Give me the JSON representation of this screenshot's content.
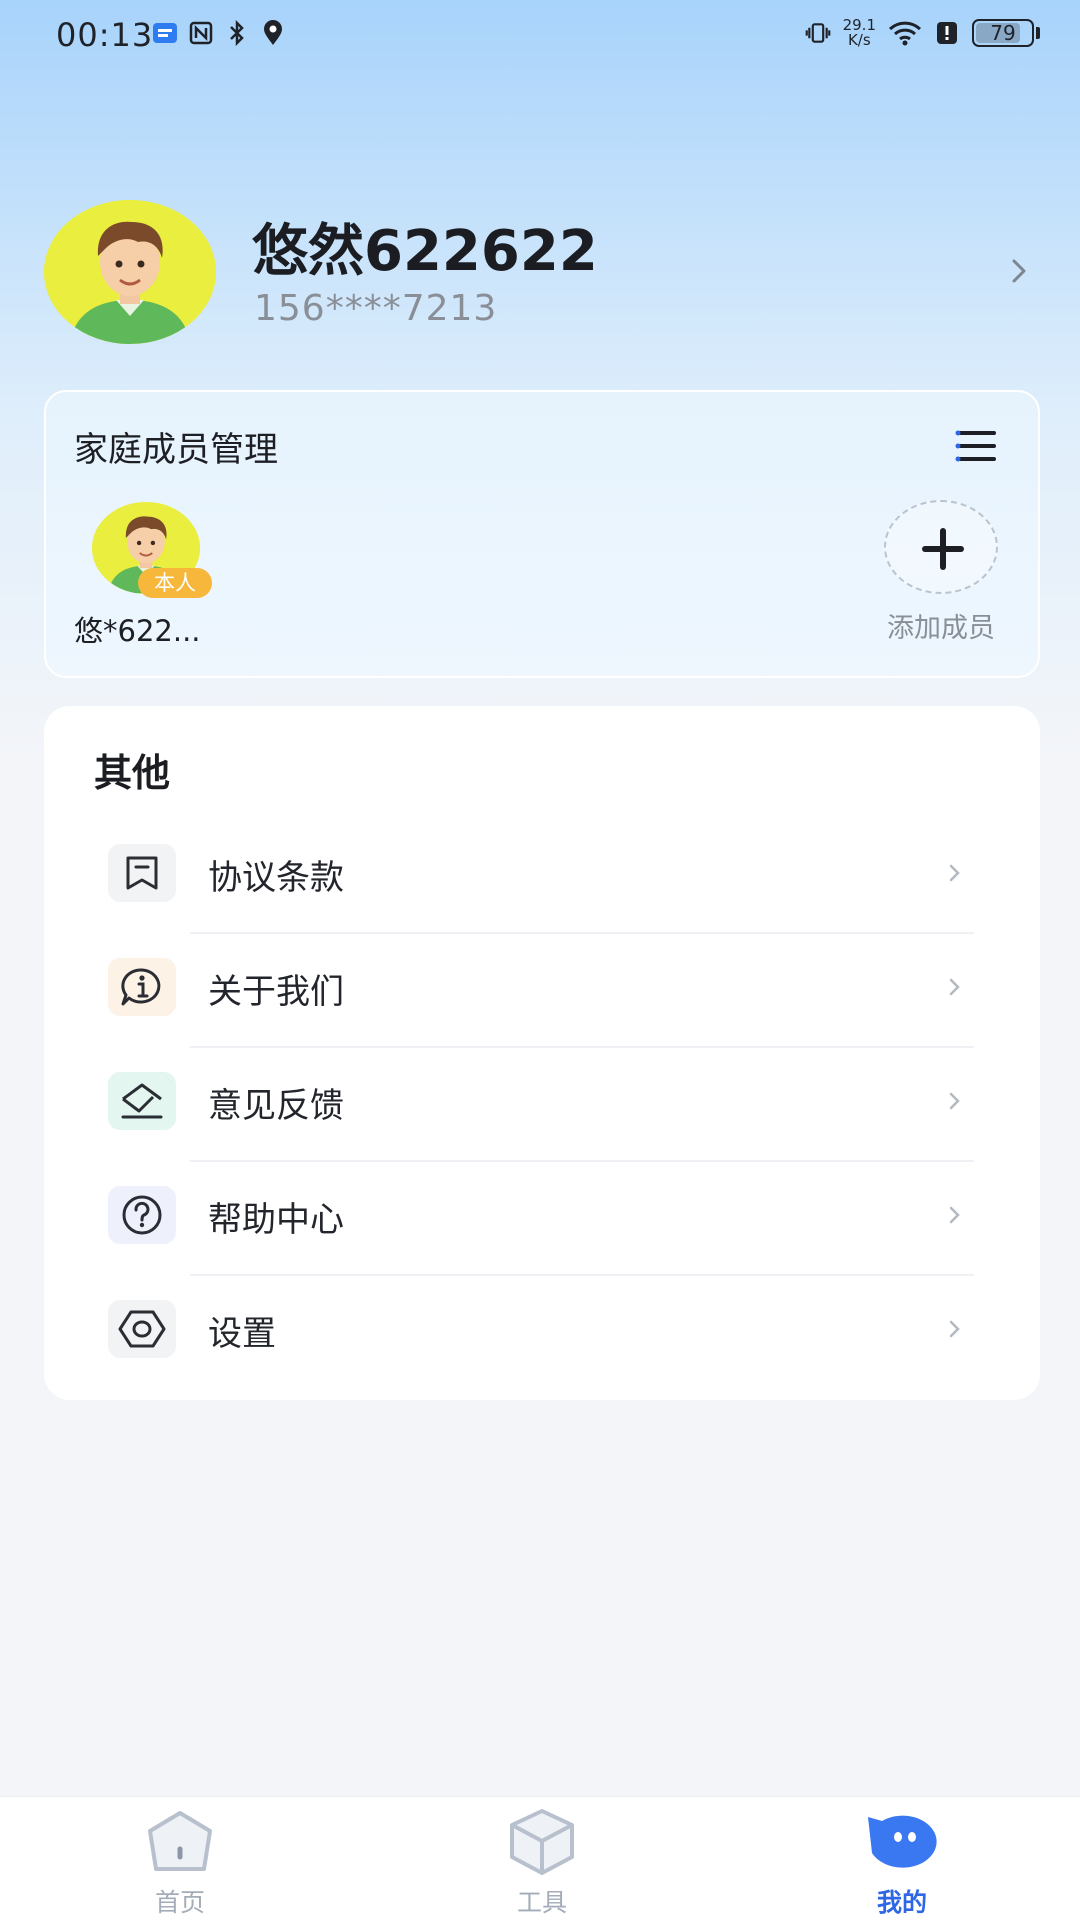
{
  "status_bar": {
    "time": "00:13",
    "net_speed_value": "29.1",
    "net_speed_unit": "K/s",
    "battery": "79",
    "battery_level": 0.79
  },
  "profile": {
    "name": "悠然622622",
    "phone": "156****7213"
  },
  "family": {
    "title": "家庭成员管理",
    "members": [
      {
        "name": "悠*622...",
        "badge": "本人"
      }
    ],
    "add_label": "添加成员"
  },
  "other": {
    "title": "其他",
    "items": [
      {
        "label": "协议条款",
        "icon": "bookmark-icon",
        "icon_bg": "#f2f3f5"
      },
      {
        "label": "关于我们",
        "icon": "info-chat-icon",
        "icon_bg": "#fdf2e6"
      },
      {
        "label": "意见反馈",
        "icon": "envelope-pen-icon",
        "icon_bg": "#e3f6ef"
      },
      {
        "label": "帮助中心",
        "icon": "help-circle-icon",
        "icon_bg": "#eef1fb"
      },
      {
        "label": "设置",
        "icon": "hexagon-settings-icon",
        "icon_bg": "#f2f3f5"
      }
    ]
  },
  "bottom_nav": {
    "items": [
      {
        "label": "首页",
        "icon": "home-icon"
      },
      {
        "label": "工具",
        "icon": "box-icon"
      },
      {
        "label": "我的",
        "icon": "chat-bubble-icon",
        "active": true
      }
    ]
  },
  "colors": {
    "accent": "#2e67e6",
    "badge": "#f6b73a",
    "avatar_bg": "#eaee3f"
  }
}
